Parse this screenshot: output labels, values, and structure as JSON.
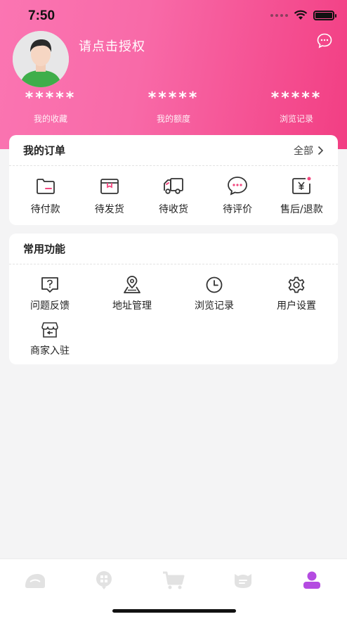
{
  "status_bar": {
    "time": "7:50"
  },
  "profile": {
    "auth_prompt": "请点击授权"
  },
  "stats": [
    {
      "value": "*****",
      "label": "我的收藏"
    },
    {
      "value": "*****",
      "label": "我的额度"
    },
    {
      "value": "*****",
      "label": "浏览记录"
    }
  ],
  "orders": {
    "title": "我的订单",
    "all_label": "全部",
    "items": [
      {
        "label": "待付款",
        "icon": "wallet-icon"
      },
      {
        "label": "待发货",
        "icon": "box-icon"
      },
      {
        "label": "待收货",
        "icon": "truck-icon"
      },
      {
        "label": "待评价",
        "icon": "comment-icon"
      },
      {
        "label": "售后/退款",
        "icon": "refund-icon"
      }
    ]
  },
  "functions": {
    "title": "常用功能",
    "items": [
      {
        "label": "问题反馈",
        "icon": "help-icon"
      },
      {
        "label": "地址管理",
        "icon": "location-icon"
      },
      {
        "label": "浏览记录",
        "icon": "clock-icon"
      },
      {
        "label": "用户设置",
        "icon": "gear-icon"
      },
      {
        "label": "商家入驻",
        "icon": "shop-icon"
      }
    ]
  },
  "tabbar": {
    "items": [
      {
        "icon": "home-icon"
      },
      {
        "icon": "category-icon"
      },
      {
        "icon": "cart-icon"
      },
      {
        "icon": "message-icon"
      },
      {
        "icon": "profile-icon"
      }
    ],
    "active_color": "#b44be1",
    "inactive_color": "#e2e2e2"
  },
  "colors": {
    "accent": "#f23e83",
    "header_start": "#fb75b2"
  }
}
